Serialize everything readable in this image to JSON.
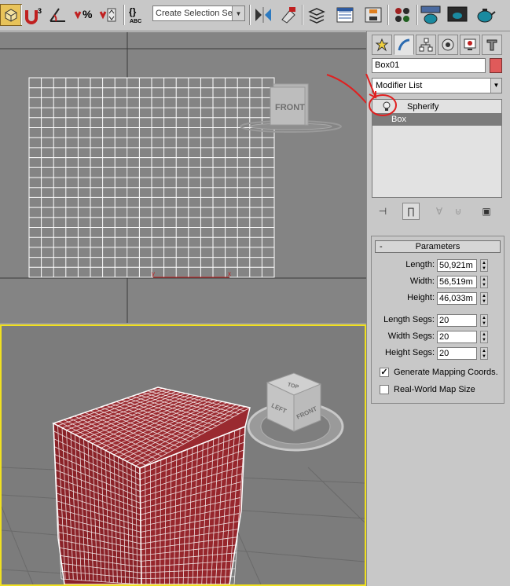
{
  "toolbar": {
    "selection_set_placeholder": "Create Selection Set",
    "buttons": [
      {
        "name": "select-object-icon",
        "glyph": "▣"
      },
      {
        "name": "snap-3d-icon",
        "glyph": "∩³"
      },
      {
        "name": "angle-snap-icon",
        "glyph": "∠"
      },
      {
        "name": "percent-snap-icon",
        "glyph": "%"
      },
      {
        "name": "spinner-snap-icon",
        "glyph": "⇕"
      },
      {
        "name": "named-selection-icon",
        "glyph": "{}"
      },
      {
        "name": "mirror-icon",
        "glyph": "⋈"
      },
      {
        "name": "align-icon",
        "glyph": "⊿"
      },
      {
        "name": "layer-manager-icon",
        "glyph": "≣"
      },
      {
        "name": "curve-editor-icon",
        "glyph": "▦"
      },
      {
        "name": "schematic-view-icon",
        "glyph": "⊟"
      },
      {
        "name": "material-editor-icon",
        "glyph": "⁘"
      },
      {
        "name": "render-setup-icon",
        "glyph": "☕"
      },
      {
        "name": "rendered-frame-icon",
        "glyph": "▣"
      },
      {
        "name": "render-production-icon",
        "glyph": "☕"
      }
    ]
  },
  "viewports": {
    "top": {
      "viewcube_label": "FRONT"
    },
    "perspective": {
      "viewcube_top": "TOP",
      "viewcube_left": "LEFT",
      "viewcube_front": "FRONT"
    }
  },
  "command_panel": {
    "tabs": [
      "create-tab",
      "modify-tab",
      "hierarchy-tab",
      "motion-tab",
      "display-tab",
      "utilities-tab"
    ],
    "object_name": "Box01",
    "object_color": "#e05a5a",
    "modifier_list": "Modifier List",
    "stack": [
      "Spherify",
      "Box"
    ],
    "parameters": {
      "title": "Parameters",
      "collapse": "-",
      "length_label": "Length:",
      "length": "50,921m",
      "width_label": "Width:",
      "width": "56,519m",
      "height_label": "Height:",
      "height": "46,033m",
      "length_segs_label": "Length Segs:",
      "length_segs": "20",
      "width_segs_label": "Width Segs:",
      "width_segs": "20",
      "height_segs_label": "Height Segs:",
      "height_segs": "20",
      "gen_mapping_label": "Generate Mapping Coords.",
      "gen_mapping_checked": true,
      "real_world_label": "Real-World Map Size",
      "real_world_checked": false
    }
  },
  "annotation_color": "#e02020"
}
